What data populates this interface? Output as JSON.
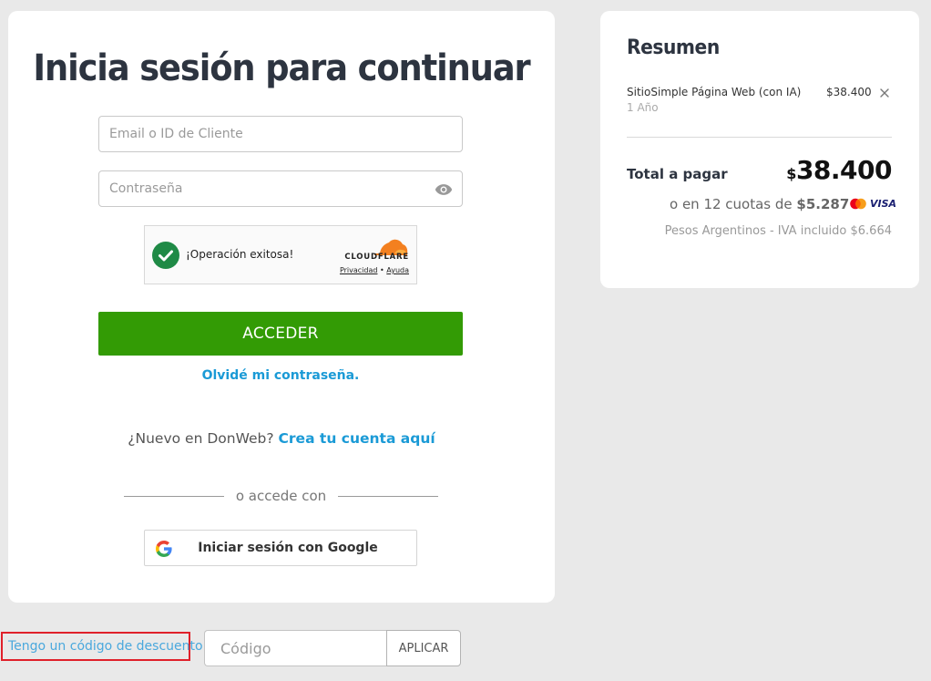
{
  "login": {
    "title": "Inicia sesión para continuar",
    "email_placeholder": "Email o ID de Cliente",
    "password_placeholder": "Contraseña",
    "captcha": {
      "status": "¡Operación exitosa!",
      "brand": "CLOUDFLARE",
      "privacy": "Privacidad",
      "separator": " • ",
      "help": "Ayuda"
    },
    "submit_label": "ACCEDER",
    "forgot_label": "Olvidé mi contraseña.",
    "signup_prompt": "¿Nuevo en DonWeb? ",
    "signup_link": "Crea tu cuenta aquí",
    "divider_text": "o accede con",
    "google_label": "Iniciar sesión con Google"
  },
  "discount": {
    "link_label": "Tengo un código de descuento",
    "code_placeholder": "Código",
    "apply_label": "APLICAR"
  },
  "summary": {
    "title": "Resumen",
    "item": {
      "name": "SitioSimple Página Web (con IA)",
      "term": "1 Año",
      "price": "$38.400"
    },
    "total_label": "Total a pagar",
    "total_currency": "$",
    "total_amount": "38.400",
    "installments_prefix": "o en 12 cuotas de ",
    "installments_amount": "$5.287",
    "visa_label": "VISA",
    "tax_note": "Pesos Argentinos - IVA incluido $6.664"
  },
  "colors": {
    "primary_green": "#339b05",
    "link_blue": "#1a9ad6",
    "highlight_red": "#e0202a"
  }
}
